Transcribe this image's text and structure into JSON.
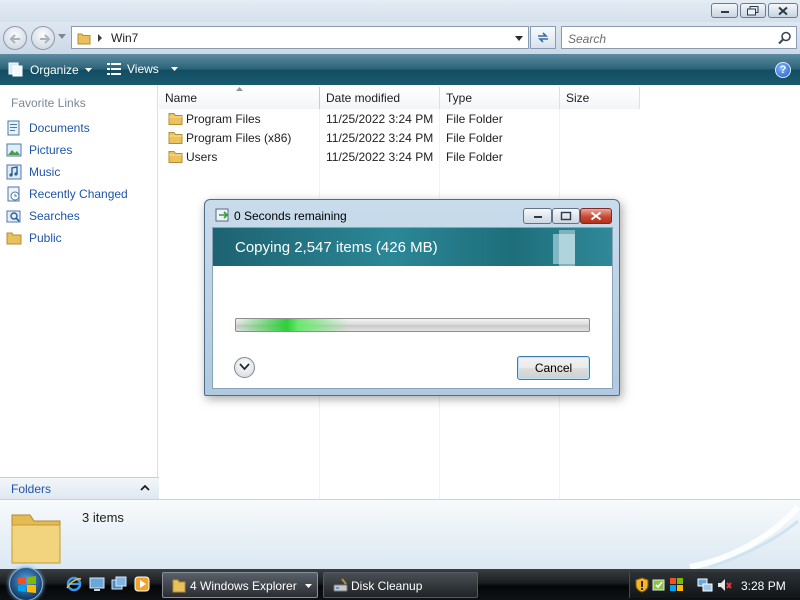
{
  "window": {
    "controls": {
      "minimize_icon": "minimize-icon",
      "maximize_icon": "restore-icon",
      "close_icon": "close-icon"
    }
  },
  "address": {
    "path": "Win7",
    "search_placeholder": "Search"
  },
  "command_bar": {
    "organize_label": "Organize",
    "views_label": "Views",
    "help_label": "?"
  },
  "nav_pane": {
    "heading": "Favorite Links",
    "items": [
      {
        "label": "Documents",
        "icon": "documents-icon"
      },
      {
        "label": "Pictures",
        "icon": "pictures-icon"
      },
      {
        "label": "Music",
        "icon": "music-icon"
      },
      {
        "label": "Recently Changed",
        "icon": "recent-icon"
      },
      {
        "label": "Searches",
        "icon": "searches-icon"
      },
      {
        "label": "Public",
        "icon": "folder-icon"
      }
    ],
    "folders_label": "Folders"
  },
  "file_list": {
    "columns": [
      "Name",
      "Date modified",
      "Type",
      "Size"
    ],
    "rows": [
      {
        "name": "Program Files",
        "date": "11/25/2022 3:24 PM",
        "type": "File Folder",
        "size": ""
      },
      {
        "name": "Program Files (x86)",
        "date": "11/25/2022 3:24 PM",
        "type": "File Folder",
        "size": ""
      },
      {
        "name": "Users",
        "date": "11/25/2022 3:24 PM",
        "type": "File Folder",
        "size": ""
      }
    ]
  },
  "details_pane": {
    "item_count": "3 items"
  },
  "copy_dialog": {
    "title": "0 Seconds remaining",
    "heading": "Copying 2,547 items (426 MB)",
    "progress_percent": 32,
    "cancel_label": "Cancel"
  },
  "taskbar": {
    "buttons": [
      {
        "label": "4 Windows Explorer",
        "icon": "folder-icon"
      },
      {
        "label": "Disk Cleanup",
        "icon": "disk-cleanup-icon"
      }
    ],
    "clock": "3:28 PM"
  },
  "colors": {
    "command_bar": "#1a5a70",
    "link_blue": "#1f55a8",
    "dialog_header": "#1d6372",
    "progress_green": "#2fcf3a"
  }
}
